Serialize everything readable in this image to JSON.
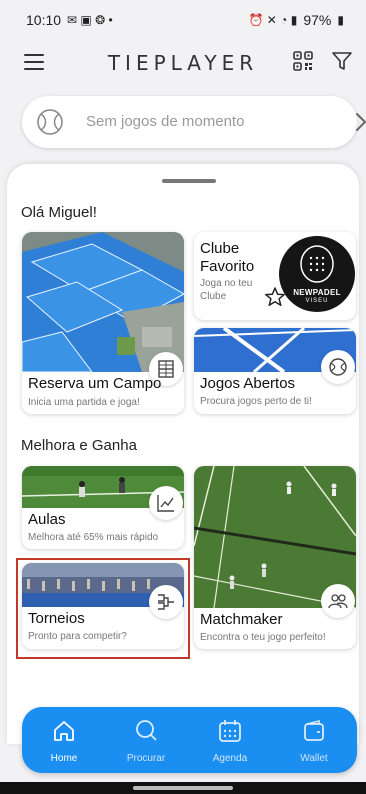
{
  "status_bar": {
    "time": "10:10",
    "battery": "97%"
  },
  "app": {
    "title": "TIEPLAYER"
  },
  "no_games": {
    "text": "Sem jogos de momento"
  },
  "greeting": "Olá Miguel!",
  "section_improve": "Melhora e Ganha",
  "cards": {
    "reserva": {
      "title": "Reserva um Campo",
      "subtitle": "Inicia uma partida e joga!"
    },
    "clube": {
      "title_line1": "Clube",
      "title_line2": "Favorito",
      "subtitle_line1": "Joga no teu",
      "subtitle_line2": "Clube",
      "logo_line1": "NEWPADEL",
      "logo_line2": "VISEU"
    },
    "jogos": {
      "title": "Jogos Abertos",
      "subtitle": "Procura jogos perto de ti!"
    },
    "aulas": {
      "title": "Aulas",
      "subtitle": "Melhora até 65% mais rápido"
    },
    "torneios": {
      "title": "Torneios",
      "subtitle": "Pronto para competir?"
    },
    "matchmaker": {
      "title": "Matchmaker",
      "subtitle": "Encontra o teu jogo perfeito!"
    }
  },
  "nav": [
    {
      "label": "Home",
      "icon": "home-icon",
      "active": true
    },
    {
      "label": "Procurar",
      "icon": "search-icon",
      "active": false
    },
    {
      "label": "Agenda",
      "icon": "calendar-icon",
      "active": false
    },
    {
      "label": "Wallet",
      "icon": "wallet-icon",
      "active": false
    }
  ],
  "colors": {
    "accent": "#1b8ef2",
    "highlight_border": "#c0392b",
    "court_blue": "#2f7fd6",
    "court_green": "#4f8a3a"
  }
}
